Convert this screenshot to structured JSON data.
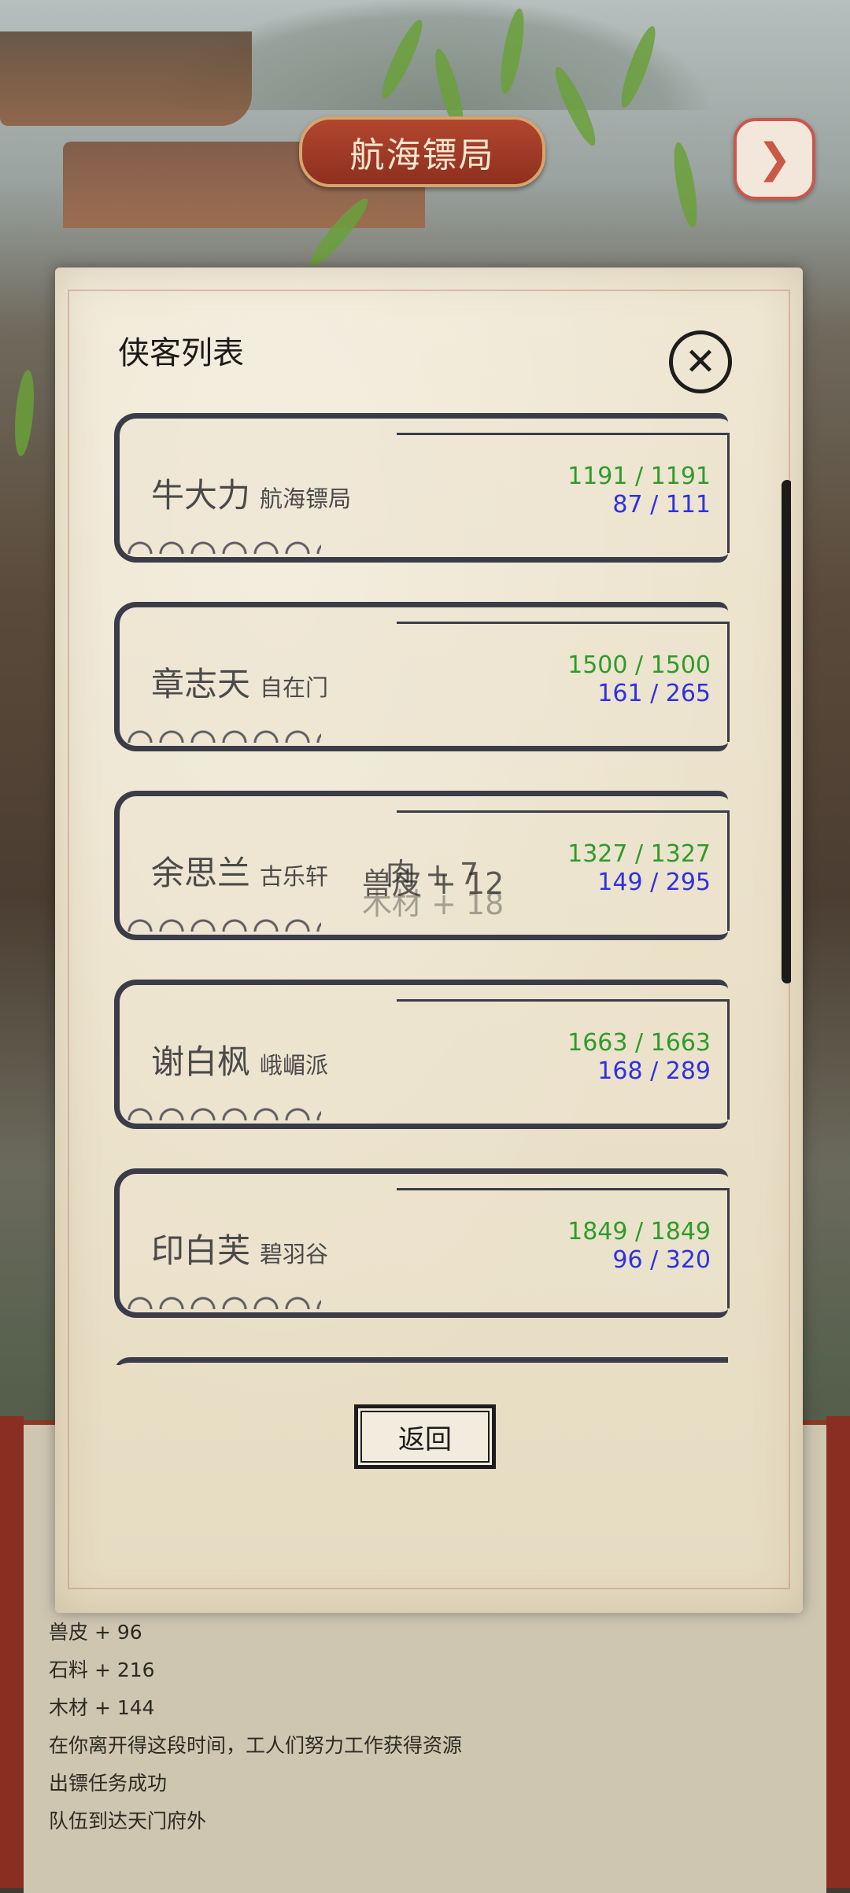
{
  "header": {
    "location_title": "航海镖局"
  },
  "dialog": {
    "title": "侠客列表",
    "back_label": "返回"
  },
  "heroes": [
    {
      "name": "牛大力",
      "sect": "航海镖局",
      "hp": "1191 / 1191",
      "mp": "87 / 111"
    },
    {
      "name": "章志天",
      "sect": "自在门",
      "hp": "1500 / 1500",
      "mp": "161 / 265"
    },
    {
      "name": "余思兰",
      "sect": "古乐轩",
      "hp": "1327 / 1327",
      "mp": "149 / 295"
    },
    {
      "name": "谢白枫",
      "sect": "峨嵋派",
      "hp": "1663 / 1663",
      "mp": "168 / 289"
    },
    {
      "name": "印白芙",
      "sect": "碧羽谷",
      "hp": "1849 / 1849",
      "mp": "96 / 320"
    }
  ],
  "popups": [
    "肉 + 7",
    "兽皮 + 12",
    "木材 + 18"
  ],
  "log": [
    "兽皮 + 96",
    "石料 + 216",
    "木材 + 144",
    "在你离开得这段时间，工人们努力工作获得资源",
    "出镖任务成功",
    "队伍到达天门府外"
  ],
  "colors": {
    "hp": "#2f9b2a",
    "mp": "#2d32e0",
    "banner": "#a03c28"
  },
  "icons": {
    "next": "arrow-right-icon",
    "close": "close-icon"
  }
}
